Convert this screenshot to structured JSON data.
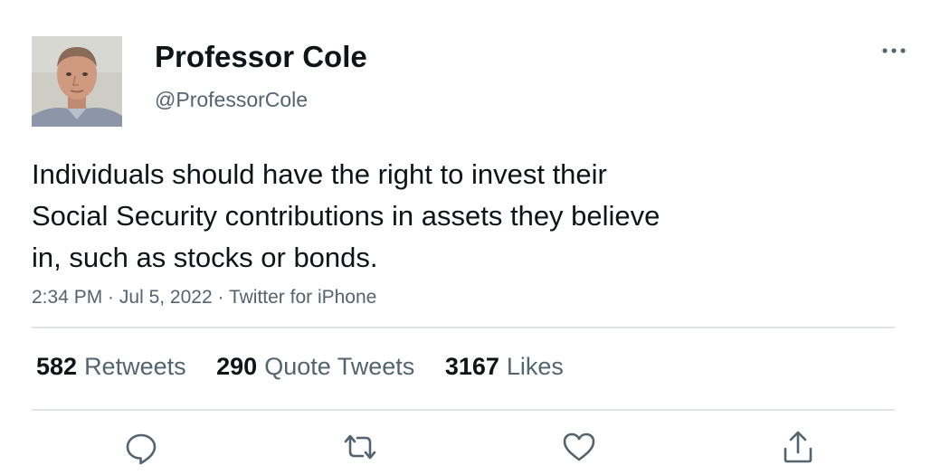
{
  "author": {
    "display_name": "Professor Cole",
    "handle": "@ProfessorCole"
  },
  "tweet": {
    "text": "Individuals should have the right to invest their\nSocial Security contributions in assets they believe\nin, such as stocks or bonds.",
    "time": "2:34 PM",
    "date": "Jul 5, 2022",
    "source": "Twitter for iPhone",
    "separator": " · "
  },
  "stats": {
    "retweets": {
      "count": "582",
      "label": "Retweets"
    },
    "quotes": {
      "count": "290",
      "label": "Quote Tweets"
    },
    "likes": {
      "count": "3167",
      "label": "Likes"
    }
  },
  "actions": {
    "icons": [
      "reply-icon",
      "retweet-icon",
      "like-icon",
      "share-icon"
    ]
  },
  "colors": {
    "text_primary": "#0f1419",
    "text_secondary": "#536471",
    "divider": "#e1e4e7"
  }
}
